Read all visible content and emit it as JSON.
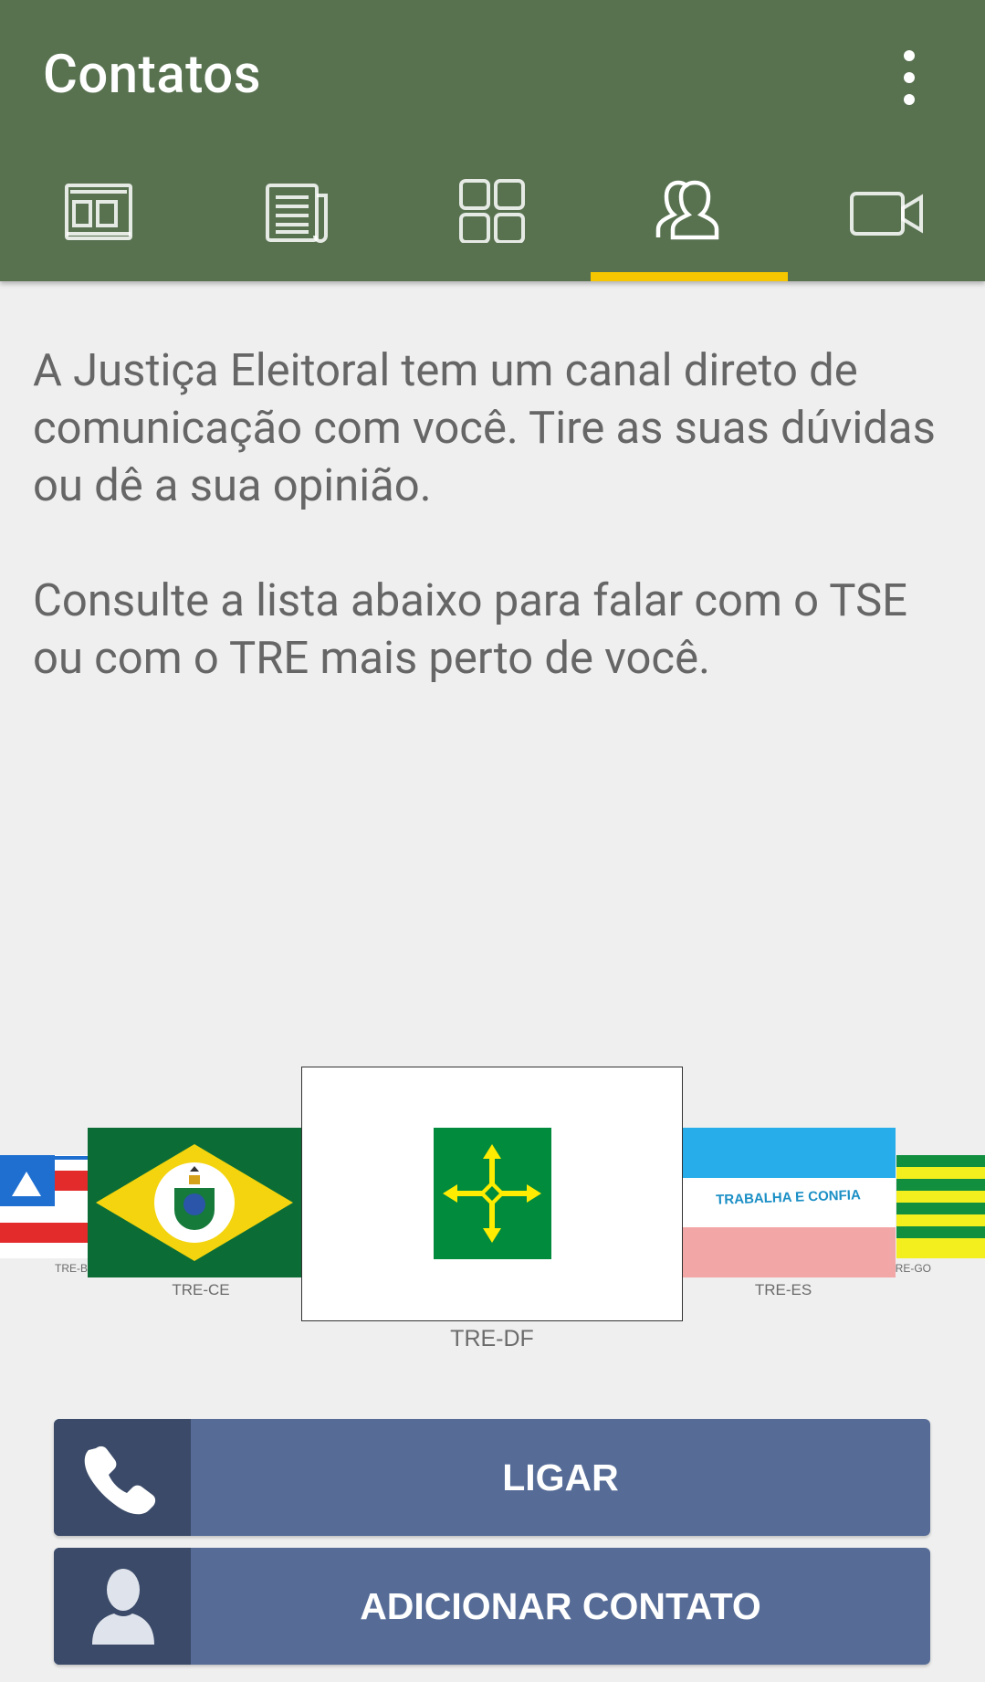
{
  "header": {
    "title": "Contatos",
    "menu_icon": "more-vert-icon"
  },
  "tabs": [
    {
      "icon": "layout-icon",
      "selected": false
    },
    {
      "icon": "newspaper-icon",
      "selected": false
    },
    {
      "icon": "grid-icon",
      "selected": false
    },
    {
      "icon": "contacts-icon",
      "selected": true
    },
    {
      "icon": "video-icon",
      "selected": false
    }
  ],
  "intro": {
    "paragraph1": "A Justiça Eleitoral tem um canal direto de comunicação com você. Tire as suas dúvidas ou dê a sua opinião.",
    "paragraph2": "Consulte a lista abaixo para falar com o TSE ou com o TRE mais perto de você."
  },
  "carousel": {
    "items": [
      {
        "label": "TRE-B"
      },
      {
        "label": "TRE-CE"
      },
      {
        "label": "TRE-DF",
        "selected": true
      },
      {
        "label": "TRE-ES",
        "motto": "TRABALHA E CONFIA"
      },
      {
        "label": "RE-GO"
      }
    ]
  },
  "actions": {
    "call_label": "LIGAR",
    "add_contact_label": "ADICIONAR CONTATO"
  },
  "colors": {
    "appbar": "#587250",
    "indicator": "#f6c700",
    "button": "#566c97",
    "button_icon_bg": "#3a4a68",
    "background": "#efefef"
  }
}
